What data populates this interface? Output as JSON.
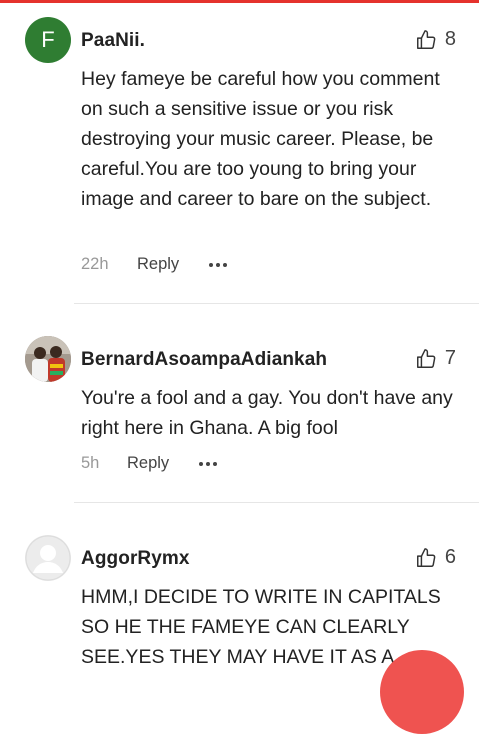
{
  "comments": [
    {
      "avatar_letter": "F",
      "avatar_color": "#2f7d32",
      "username": "PaaNii.",
      "likes": "8",
      "text": "Hey fameye be careful how you comment on such a sensitive issue or you risk destroying your music career. Please, be careful.You are too young to bring your image and career to bare on the subject.",
      "time": "22h",
      "reply_label": "Reply"
    },
    {
      "username": "BernardAsoampaAdiankah",
      "likes": "7",
      "text": "You're a fool and a gay. You don't have any right here in Ghana. A big fool",
      "time": "5h",
      "reply_label": "Reply"
    },
    {
      "username": "AggorRymx",
      "likes": "6",
      "text": "HMM,I DECIDE TO WRITE IN CAPITALS SO HE THE FAMEYE CAN CLEARLY SEE.YES THEY MAY HAVE IT AS A"
    }
  ],
  "colors": {
    "accent": "#e5322d",
    "fab": "#ef5350"
  }
}
